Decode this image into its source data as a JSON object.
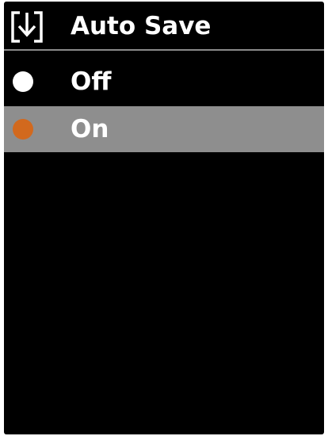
{
  "header": {
    "icon": "save-download-icon",
    "title": "Auto Save"
  },
  "options": [
    {
      "label": "Off",
      "selected": false,
      "dot_color": "#ffffff"
    },
    {
      "label": "On",
      "selected": true,
      "dot_color": "#d2691e"
    }
  ],
  "colors": {
    "background": "#000000",
    "selection_highlight": "#8e8e8e",
    "text": "#ffffff",
    "accent": "#d2691e"
  }
}
